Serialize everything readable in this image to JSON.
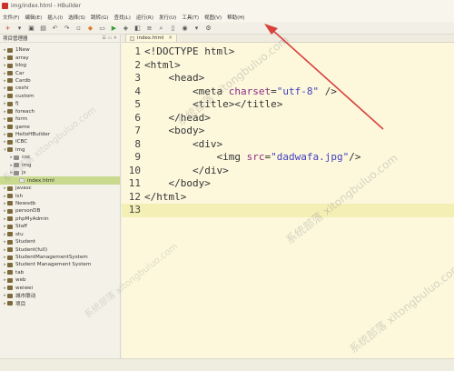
{
  "window": {
    "title": "img/index.html - HBuilder"
  },
  "menu": [
    "文件(F)",
    "编辑(E)",
    "插入(I)",
    "选择(S)",
    "跳转(G)",
    "查找(L)",
    "运行(R)",
    "发行(U)",
    "工具(T)",
    "视图(V)",
    "帮助(H)"
  ],
  "toolbar": {
    "icons": [
      "plus-icon",
      "dropdown-icon",
      "save-icon",
      "save-all-icon",
      "undo-icon",
      "redo-icon",
      "new-file-icon",
      "html-icon",
      "browse-icon",
      "run-icon",
      "debug-icon",
      "preview-icon",
      "format-icon",
      "find-icon",
      "phone-icon",
      "browser-icon",
      "dropdown-icon",
      "settings-icon"
    ]
  },
  "sidebar": {
    "title": "项目管理器",
    "controls": "☰ ▭ ✕",
    "items": [
      {
        "label": "1New",
        "type": "proj",
        "level": 0,
        "expanded": false
      },
      {
        "label": "array",
        "type": "proj",
        "level": 0,
        "expanded": false
      },
      {
        "label": "blog",
        "type": "proj",
        "level": 0,
        "expanded": false
      },
      {
        "label": "Car",
        "type": "proj",
        "level": 0,
        "expanded": false
      },
      {
        "label": "Cardb",
        "type": "proj",
        "level": 0,
        "expanded": false
      },
      {
        "label": "ceshi",
        "type": "proj",
        "level": 0,
        "expanded": false
      },
      {
        "label": "custom",
        "type": "proj",
        "level": 0,
        "expanded": false
      },
      {
        "label": "fj",
        "type": "proj",
        "level": 0,
        "expanded": false
      },
      {
        "label": "foreach",
        "type": "proj",
        "level": 0,
        "expanded": false
      },
      {
        "label": "form",
        "type": "proj",
        "level": 0,
        "expanded": false
      },
      {
        "label": "game",
        "type": "proj",
        "level": 0,
        "expanded": false
      },
      {
        "label": "HelloHBuilder",
        "type": "proj",
        "level": 0,
        "expanded": false
      },
      {
        "label": "ICBC",
        "type": "proj",
        "level": 0,
        "expanded": false
      },
      {
        "label": "img",
        "type": "proj",
        "level": 0,
        "expanded": true
      },
      {
        "label": "css",
        "type": "folder",
        "level": 1,
        "expanded": false
      },
      {
        "label": "img",
        "type": "folder",
        "level": 1,
        "expanded": false
      },
      {
        "label": "js",
        "type": "folder",
        "level": 1,
        "expanded": false
      },
      {
        "label": "index.html",
        "type": "file",
        "level": 2,
        "expanded": false,
        "selected": true
      },
      {
        "label": "javasc",
        "type": "proj",
        "level": 0,
        "expanded": false
      },
      {
        "label": "lsh",
        "type": "proj",
        "level": 0,
        "expanded": false
      },
      {
        "label": "Newsdb",
        "type": "proj",
        "level": 0,
        "expanded": false
      },
      {
        "label": "personDB",
        "type": "proj",
        "level": 0,
        "expanded": false
      },
      {
        "label": "phpMyAdmin",
        "type": "proj",
        "level": 0,
        "expanded": false
      },
      {
        "label": "Staff",
        "type": "proj",
        "level": 0,
        "expanded": false
      },
      {
        "label": "stu",
        "type": "proj",
        "level": 0,
        "expanded": false
      },
      {
        "label": "Student",
        "type": "proj",
        "level": 0,
        "expanded": false
      },
      {
        "label": "Student(full)",
        "type": "proj",
        "level": 0,
        "expanded": false
      },
      {
        "label": "StudentManagementSystem",
        "type": "proj",
        "level": 0,
        "expanded": false
      },
      {
        "label": "Student Management System",
        "type": "proj",
        "level": 0,
        "expanded": false
      },
      {
        "label": "tab",
        "type": "proj",
        "level": 0,
        "expanded": false
      },
      {
        "label": "web",
        "type": "proj",
        "level": 0,
        "expanded": false
      },
      {
        "label": "weiwei",
        "type": "proj",
        "level": 0,
        "expanded": false
      },
      {
        "label": "城市联动",
        "type": "proj",
        "level": 0,
        "expanded": false
      },
      {
        "label": "项目",
        "type": "proj",
        "level": 0,
        "expanded": false
      }
    ]
  },
  "editor": {
    "tab_label": "index.html",
    "tab_close": "✕",
    "current_line": 13,
    "lines": [
      {
        "n": "1",
        "indent": "",
        "tokens": [
          [
            "punc",
            "<!DOCTYPE html>"
          ]
        ]
      },
      {
        "n": "2",
        "indent": "",
        "tokens": [
          [
            "punc",
            "<html>"
          ]
        ]
      },
      {
        "n": "3",
        "indent": "    ",
        "tokens": [
          [
            "punc",
            "<head>"
          ]
        ]
      },
      {
        "n": "4",
        "indent": "        ",
        "tokens": [
          [
            "punc",
            "<meta "
          ],
          [
            "attr",
            "charset"
          ],
          [
            "punc",
            "="
          ],
          [
            "val",
            "\"utf-8\""
          ],
          [
            "punc",
            " />"
          ]
        ]
      },
      {
        "n": "5",
        "indent": "        ",
        "tokens": [
          [
            "punc",
            "<title></title>"
          ]
        ]
      },
      {
        "n": "6",
        "indent": "    ",
        "tokens": [
          [
            "punc",
            "</head>"
          ]
        ]
      },
      {
        "n": "7",
        "indent": "    ",
        "tokens": [
          [
            "punc",
            "<body>"
          ]
        ]
      },
      {
        "n": "8",
        "indent": "        ",
        "tokens": [
          [
            "punc",
            "<div>"
          ]
        ]
      },
      {
        "n": "9",
        "indent": "            ",
        "tokens": [
          [
            "punc",
            "<img "
          ],
          [
            "attr",
            "src"
          ],
          [
            "punc",
            "="
          ],
          [
            "val",
            "\"dadwafa.jpg\""
          ],
          [
            "punc",
            "/>"
          ]
        ]
      },
      {
        "n": "10",
        "indent": "        ",
        "tokens": [
          [
            "punc",
            "</div>"
          ]
        ]
      },
      {
        "n": "11",
        "indent": "    ",
        "tokens": [
          [
            "punc",
            "</body>"
          ]
        ]
      },
      {
        "n": "12",
        "indent": "",
        "tokens": [
          [
            "punc",
            "</html>"
          ]
        ]
      },
      {
        "n": "13",
        "indent": "",
        "tokens": []
      }
    ]
  },
  "colors": {
    "annotation_arrow": "#d8403a",
    "selection": "#c9d98e",
    "editor_bg": "#fdf8dc",
    "current_line": "#f4efb5"
  },
  "watermark": "系统部落 xitongbuluo.com"
}
